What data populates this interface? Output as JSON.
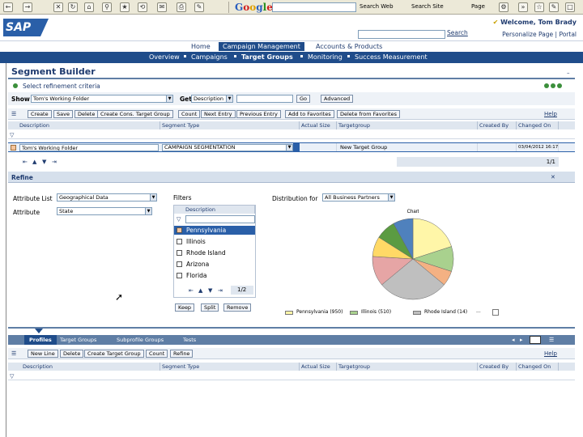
{
  "browser": {
    "search_label": "Search Web",
    "search_site_label": "Search Site",
    "page_menu": "Page"
  },
  "header": {
    "logo": "SAP",
    "welcome": "Welcome, Tom Brady",
    "links": "Personalize  Page | Portal",
    "search_button": "Search"
  },
  "top_nav": {
    "items": [
      "Home",
      "Campaign Management",
      "Accounts & Products"
    ],
    "active_index": 1
  },
  "sub_nav": {
    "items": [
      "Overview",
      "Campaigns",
      "Target Groups",
      "Monitoring",
      "Success Measurement"
    ],
    "active_index": 2
  },
  "page": {
    "title": "Segment Builder"
  },
  "refinement": {
    "label": "Select refinement criteria",
    "show_label": "Show",
    "show_value": "Tom's Working Folder",
    "get_label": "Get",
    "get_value": "Description",
    "go_button": "Go",
    "advanced_button": "Advanced",
    "toolbar": [
      "Create",
      "Save",
      "Delete",
      "Create Cons. Target Group",
      "Count",
      "Next Entry",
      "Previous Entry",
      "Add to Favorites",
      "Delete from Favorites"
    ],
    "help": "Help",
    "columns": [
      "Description",
      "Segment Type",
      "Actual Size",
      "Targetgroup",
      "Created By",
      "Changed On"
    ],
    "row": {
      "description": "Tom's Working Folder",
      "segment_type": "CAMPAIGN SEGMENTATION",
      "actual_size": "",
      "targetgroup": "New Target Group",
      "created_by": "",
      "changed_on": "03/04/2012 16:17"
    },
    "pager": "1/1"
  },
  "refine": {
    "title": "Refine",
    "attribute_list_label": "Attribute List",
    "attribute_list_value": "Geographical Data",
    "attribute_label": "Attribute",
    "attribute_value": "State",
    "filters_label": "Filters",
    "filters_column": "Description",
    "filters": [
      "Pennsylvania",
      "Illinois",
      "Rhode Island",
      "Arizona",
      "Florida"
    ],
    "filters_pager": "1/2",
    "buttons": [
      "Keep",
      "Split",
      "Remove"
    ],
    "distribution_label": "Distribution for",
    "distribution_value": "All Business Partners"
  },
  "chart_data": {
    "type": "pie",
    "title": "Chart",
    "values": [
      20,
      10,
      6,
      28,
      12,
      8,
      8,
      8
    ],
    "colors": [
      "#fff6a8",
      "#a9d18e",
      "#f4b183",
      "#bfbfbf",
      "#e6a5a5",
      "#ffd966",
      "#5b9b42",
      "#4f81bd"
    ],
    "legend": [
      {
        "label": "Pennsylvania (950)",
        "color": "#fff6a8"
      },
      {
        "label": "Illinois (510)",
        "color": "#a9d18e"
      },
      {
        "label": "Rhode Island (14)",
        "color": "#bfbfbf"
      }
    ]
  },
  "bottom": {
    "tabs": [
      "Profiles",
      "Target Groups",
      "Subprofile Groups",
      "Tests"
    ],
    "active_tab": 0,
    "toolbar": [
      "New Line",
      "Delete",
      "Create Target Group",
      "Count",
      "Refine"
    ],
    "help": "Help",
    "columns": [
      "Description",
      "Segment Type",
      "Actual Size",
      "Targetgroup",
      "Created By",
      "Changed On"
    ]
  }
}
